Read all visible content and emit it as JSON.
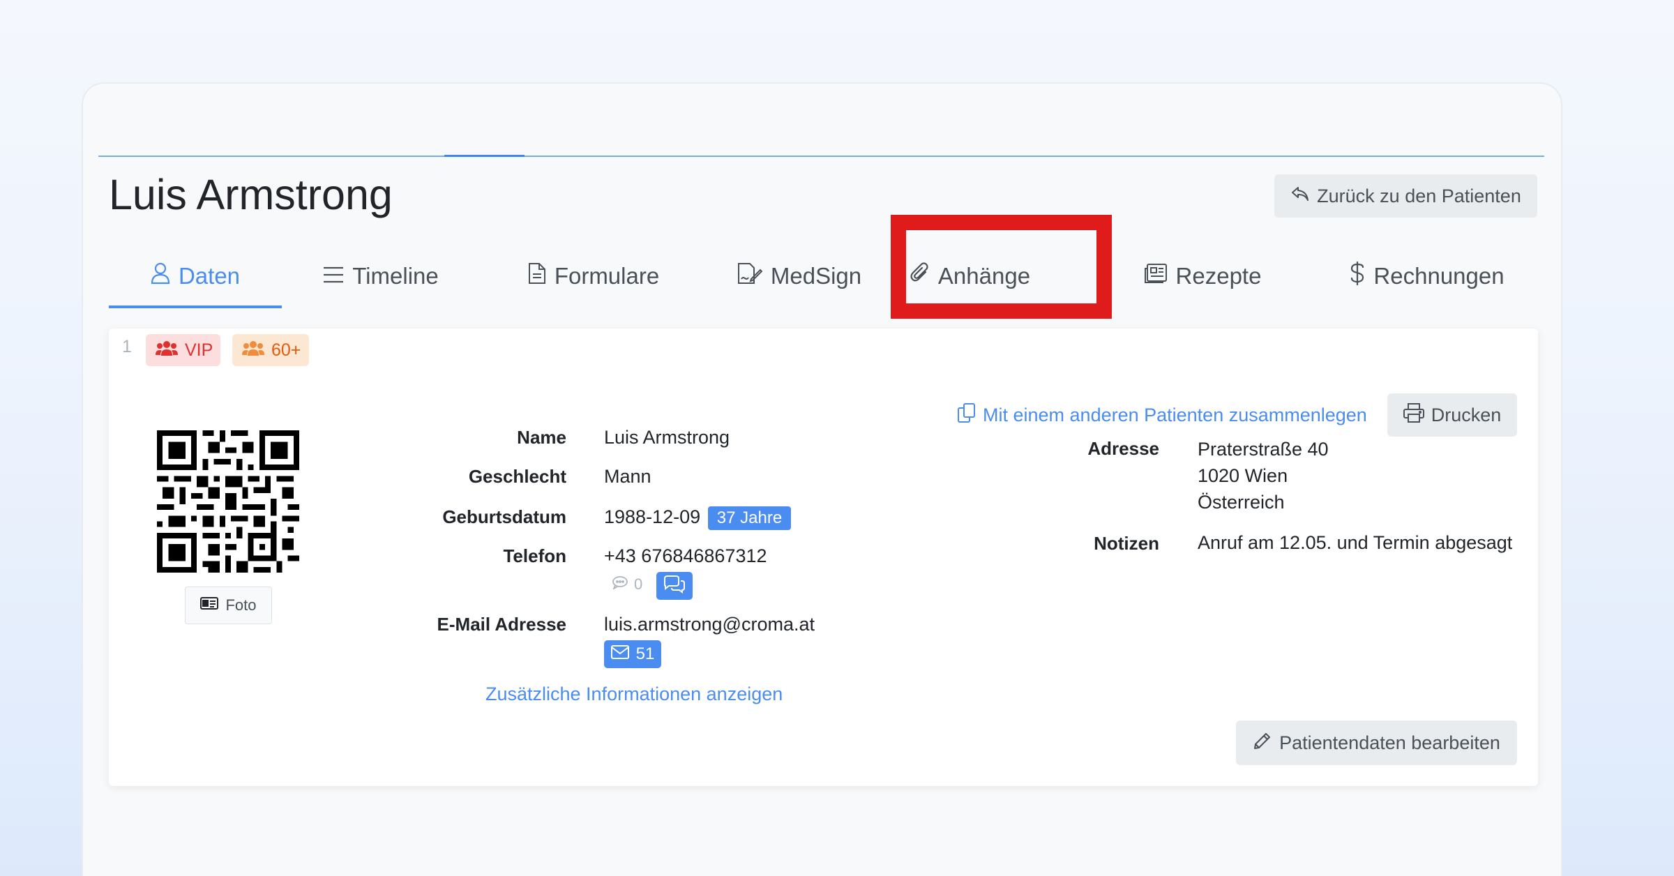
{
  "header": {
    "patient_name": "Luis Armstrong",
    "back_button_label": "Zurück zu den Patienten"
  },
  "tabs": [
    {
      "label": "Daten",
      "icon": "user-icon",
      "active": true
    },
    {
      "label": "Timeline",
      "icon": "list-icon",
      "active": false
    },
    {
      "label": "Formulare",
      "icon": "document-icon",
      "active": false
    },
    {
      "label": "MedSign",
      "icon": "signature-icon",
      "active": false
    },
    {
      "label": "Anhänge",
      "icon": "paperclip-icon",
      "active": false,
      "highlighted": true
    },
    {
      "label": "Rezepte",
      "icon": "prescription-icon",
      "active": false
    },
    {
      "label": "Rechnungen",
      "icon": "dollar-icon",
      "active": false
    }
  ],
  "card": {
    "index": "1",
    "tags": [
      {
        "label": "VIP",
        "color": "#e03131"
      },
      {
        "label": "60+",
        "color": "#e8590c"
      }
    ],
    "photo_button_label": "Foto",
    "fields": {
      "name": {
        "label": "Name",
        "value": "Luis Armstrong"
      },
      "gender": {
        "label": "Geschlecht",
        "value": "Mann"
      },
      "birthdate": {
        "label": "Geburtsdatum",
        "value": "1988-12-09",
        "age_badge": "37 Jahre"
      },
      "phone": {
        "label": "Telefon",
        "value": "+43 676846867312",
        "sms_count": "0"
      },
      "email": {
        "label": "E-Mail Adresse",
        "value": "luis.armstrong@croma.at",
        "mail_count": "51"
      }
    },
    "more_info_link": "Zusätzliche Informationen anzeigen",
    "merge_link": "Mit einem anderen Patienten zusammenlegen",
    "print_button_label": "Drucken",
    "address": {
      "label": "Adresse",
      "street": "Praterstraße 40",
      "city": "1020 Wien",
      "country": "Österreich"
    },
    "notes": {
      "label": "Notizen",
      "value": "Anruf am 12.05. und Termin abgesagt"
    },
    "edit_button_label": "Patientendaten bearbeiten"
  },
  "colors": {
    "accent": "#4a8cf0",
    "highlight": "#e01b1b",
    "vip": "#e03131",
    "senior": "#e8590c"
  }
}
